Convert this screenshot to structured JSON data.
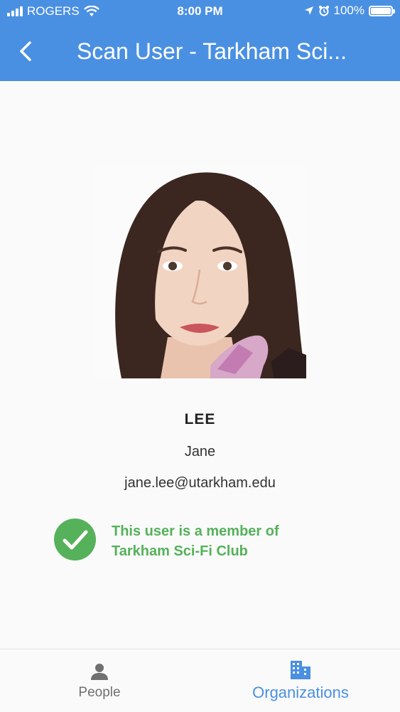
{
  "status_bar": {
    "carrier": "ROGERS",
    "time": "8:00 PM",
    "battery": "100%",
    "battery_level": 1.0
  },
  "app_bar": {
    "title": "Scan User - Tarkham Sci...",
    "back_icon": "chevron-left-icon"
  },
  "user": {
    "last_name": "LEE",
    "first_name": "Jane",
    "email": "jane.lee@utarkham.edu"
  },
  "membership": {
    "line1": "This user is a member of",
    "line2": "Tarkham Sci-Fi Club",
    "icon": "check-circle-icon",
    "color": "#55b15a"
  },
  "bottom_nav": {
    "people": {
      "label": "People",
      "icon": "person-icon"
    },
    "organizations": {
      "label": "Organizations",
      "icon": "building-icon"
    }
  },
  "colors": {
    "primary": "#4a90e2",
    "success": "#55b15a",
    "inactive": "#707070"
  }
}
